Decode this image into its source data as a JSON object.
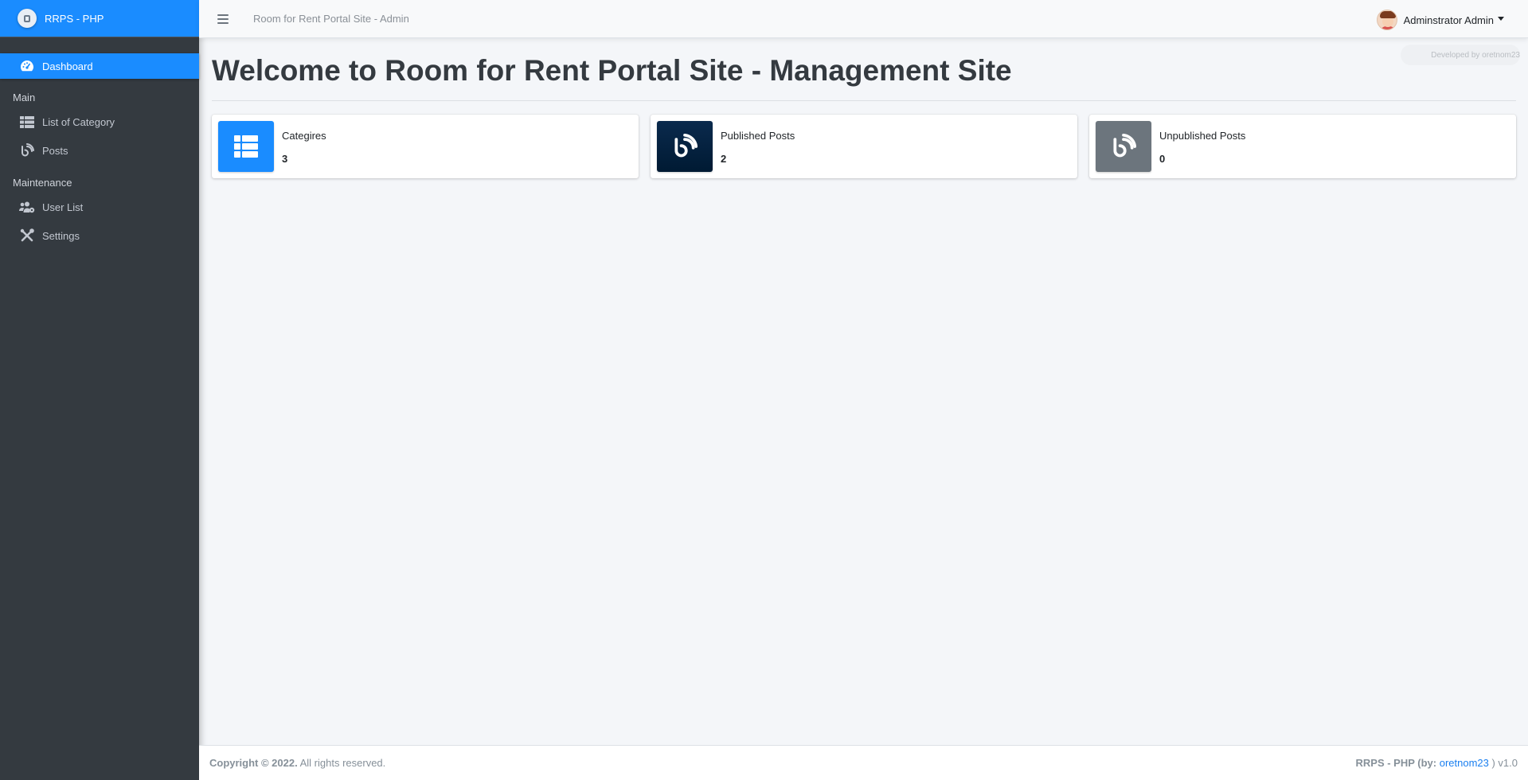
{
  "brand": {
    "name": "RRPS - PHP"
  },
  "sidebar": {
    "items": [
      {
        "label": "Dashboard",
        "icon": "dashboard-icon",
        "active": true
      },
      {
        "section": "Main"
      },
      {
        "label": "List of Category",
        "icon": "table-list-icon"
      },
      {
        "label": "Posts",
        "icon": "blog-icon"
      },
      {
        "section": "Maintenance"
      },
      {
        "label": "User List",
        "icon": "users-cog-icon"
      },
      {
        "label": "Settings",
        "icon": "tools-icon"
      }
    ]
  },
  "topbar": {
    "title": "Room for Rent Portal Site - Admin",
    "user_name": "Adminstrator Admin"
  },
  "content": {
    "developed_by": "Developed by oretnom23",
    "page_title": "Welcome to Room for Rent Portal Site - Management Site",
    "cards": [
      {
        "label": "Categires",
        "value": "3",
        "icon": "table-list-icon",
        "color": "#1a8cff"
      },
      {
        "label": "Published Posts",
        "value": "2",
        "icon": "blog-icon",
        "color": "#001f3f"
      },
      {
        "label": "Unpublished Posts",
        "value": "0",
        "icon": "blog-icon",
        "color": "#6c757d"
      }
    ]
  },
  "footer": {
    "copyright_prefix": "Copyright © 2022.",
    "copyright_suffix": " All rights reserved.",
    "credit_prefix": "RRPS - PHP (by: ",
    "credit_link": "oretnom23",
    "credit_suffix": " ) v1.0"
  },
  "colors": {
    "primary": "#1a8cff",
    "sidebar_bg": "#343a40",
    "navy": "#001f3f",
    "secondary": "#6c757d"
  }
}
